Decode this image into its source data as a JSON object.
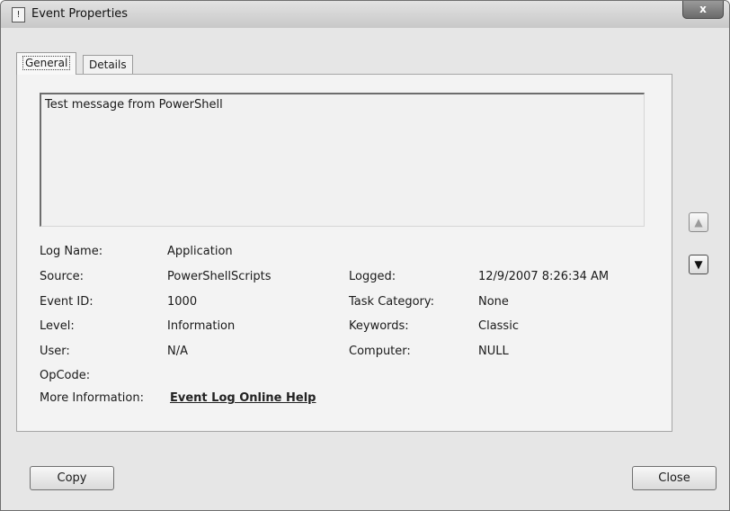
{
  "window": {
    "title": "Event Properties",
    "close_glyph": "x"
  },
  "tabs": [
    {
      "label": "General",
      "selected": true
    },
    {
      "label": "Details",
      "selected": false
    }
  ],
  "message": "Test message from PowerShell",
  "fields": {
    "log_name": {
      "label": "Log Name:",
      "value": "Application"
    },
    "source": {
      "label": "Source:",
      "value": "PowerShellScripts"
    },
    "event_id": {
      "label": "Event ID:",
      "value": "1000"
    },
    "level": {
      "label": "Level:",
      "value": "Information"
    },
    "user": {
      "label": "User:",
      "value": "N/A"
    },
    "opcode": {
      "label": "OpCode:",
      "value": ""
    },
    "more_information": {
      "label": "More Information:",
      "value": "Event Log Online Help"
    },
    "logged": {
      "label": "Logged:",
      "value": "12/9/2007 8:26:34 AM"
    },
    "task_category": {
      "label": "Task Category:",
      "value": "None"
    },
    "keywords": {
      "label": "Keywords:",
      "value": "Classic"
    },
    "computer": {
      "label": "Computer:",
      "value": "NULL"
    }
  },
  "nav": {
    "up_icon": "arrow-up",
    "down_icon": "arrow-down"
  },
  "buttons": {
    "copy": "Copy",
    "close": "Close"
  }
}
